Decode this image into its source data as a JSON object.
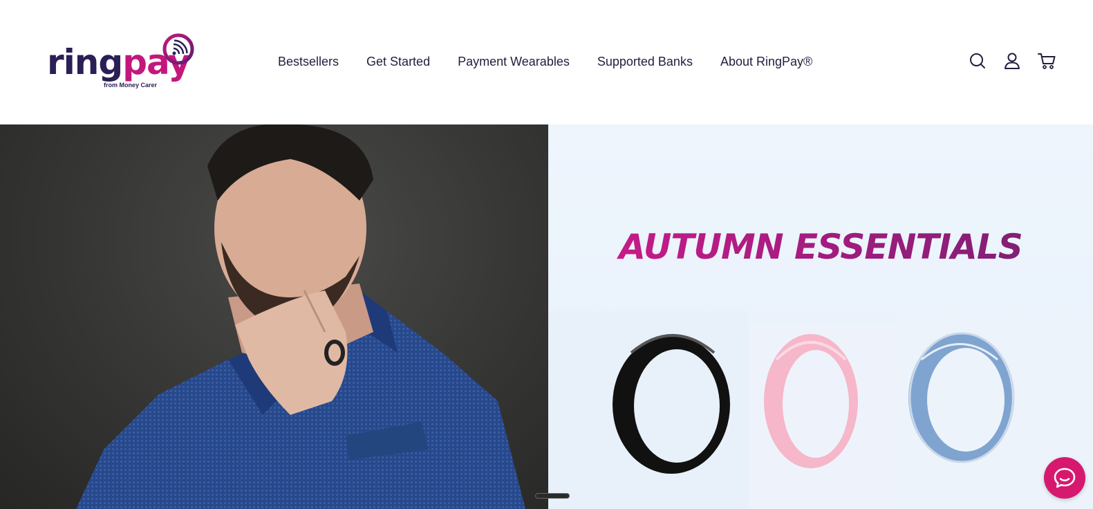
{
  "brand": {
    "logo_ring": "ring",
    "logo_pay": "pay",
    "logo_sub": "from Money Carer",
    "colors": {
      "navy": "#2b1f55",
      "magenta": "#c4177c",
      "accent": "#d6196f"
    }
  },
  "nav": {
    "items": [
      {
        "label": "Bestsellers"
      },
      {
        "label": "Get Started"
      },
      {
        "label": "Payment Wearables"
      },
      {
        "label": "Supported Banks"
      },
      {
        "label": "About RingPay®"
      }
    ]
  },
  "header_icons": [
    "search-icon",
    "account-icon",
    "cart-icon"
  ],
  "hero": {
    "banner_title": "AUTUMN ESSENTIALS",
    "rings": [
      "black",
      "pink",
      "blue"
    ]
  },
  "chat": {
    "icon": "chat-bubble-icon"
  }
}
